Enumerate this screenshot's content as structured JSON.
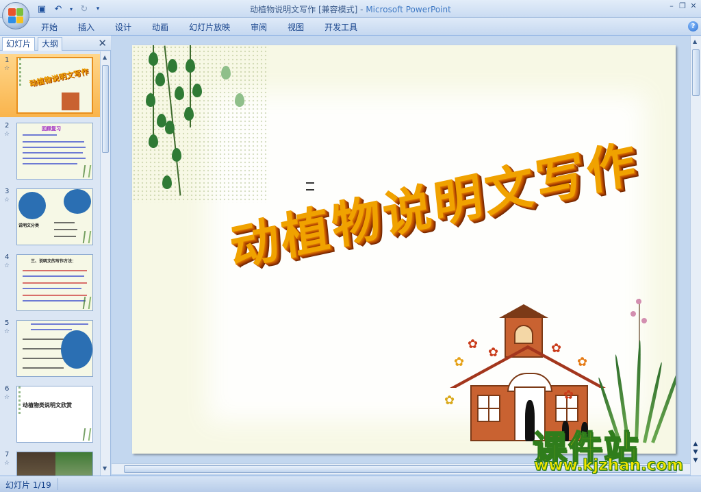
{
  "window": {
    "title": "动植物说明文写作 [兼容模式]",
    "app_name": "Microsoft PowerPoint"
  },
  "ribbon": {
    "tabs": [
      "开始",
      "插入",
      "设计",
      "动画",
      "幻灯片放映",
      "审阅",
      "视图",
      "开发工具"
    ]
  },
  "left_pane": {
    "tabs": [
      "幻灯片",
      "大纲"
    ],
    "active_tab": "幻灯片",
    "thumbnails": [
      {
        "number": "1",
        "title": "动植物说明文写作",
        "selected": true
      },
      {
        "number": "2",
        "title": "回顾复习",
        "selected": false
      },
      {
        "number": "3",
        "title": "说明文分类",
        "selected": false
      },
      {
        "number": "4",
        "title": "三、说明文的写作方法：",
        "selected": false
      },
      {
        "number": "5",
        "title": "",
        "selected": false
      },
      {
        "number": "6",
        "title": "动植物类说明文欣赏",
        "selected": false
      },
      {
        "number": "7",
        "title": "",
        "selected": false
      }
    ]
  },
  "slide": {
    "title": "动植物说明文写作"
  },
  "watermark": {
    "brand": "课件站",
    "url": "www.kjzhan.com"
  },
  "status_bar": {
    "slide_position": "幻灯片 1/19"
  },
  "colors": {
    "slide_title": "#f0a200",
    "selected_thumb": "#f9b44c",
    "ribbon_text": "#15428b"
  }
}
